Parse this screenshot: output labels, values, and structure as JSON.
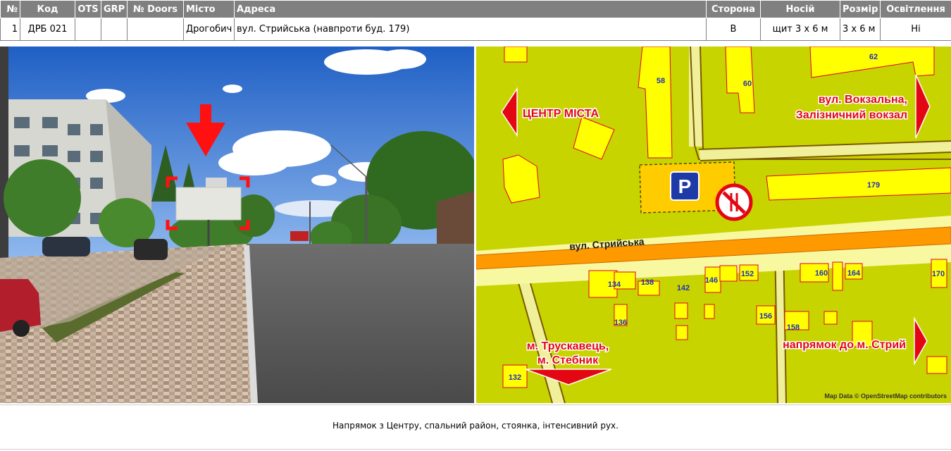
{
  "table": {
    "headers": {
      "num": "№",
      "code": "Код",
      "ots": "OTS",
      "grp": "GRP",
      "doors": "№ Doors",
      "city": "Місто",
      "address": "Адреса",
      "side": "Сторона",
      "carrier": "Носій",
      "size": "Розмір",
      "lighting": "Освітлення"
    },
    "row": {
      "num": "1",
      "code": "ДРБ 021",
      "ots": "",
      "grp": "",
      "doors": "",
      "city": "Дрогобич",
      "address": "вул. Стрийська (навпроти буд. 179)",
      "side": "B",
      "carrier": "щит 3 х 6 м",
      "size": "3 х 6 м",
      "lighting": "Ні"
    }
  },
  "map": {
    "street_main": "вул. Стрийська",
    "dir_left": "ЦЕНТР МІСТА",
    "dir_right_line1": "вул. Вокзальна,",
    "dir_right_line2": "Залізничний вокзал",
    "dir_bottom_line1": "м. Трускавець,",
    "dir_bottom_line2": "м. Стебник",
    "dir_bottom_right": "напрямок до м. Стрий",
    "parking_symbol": "P",
    "attribution": "Map Data © OpenStreetMap contributors",
    "house_numbers": {
      "h58": "58",
      "h60": "60",
      "h62": "62",
      "h179": "179",
      "h132": "132",
      "h134": "134",
      "h136": "136",
      "h138": "138",
      "h142": "142",
      "h146": "146",
      "h152": "152",
      "h156": "156",
      "h158": "158",
      "h160": "160",
      "h164": "164",
      "h170": "170"
    },
    "colors": {
      "background": "#c8d400",
      "building": "#ffff00",
      "building_outline": "#e0002a",
      "main_road": "#ff9900",
      "road_fill": "#f8f8a0",
      "label_red": "#e30613",
      "parking_blue": "#1e3aa8"
    }
  },
  "description": "Напрямок з Центру, спальний район, стоянка, інтенсивний рух."
}
